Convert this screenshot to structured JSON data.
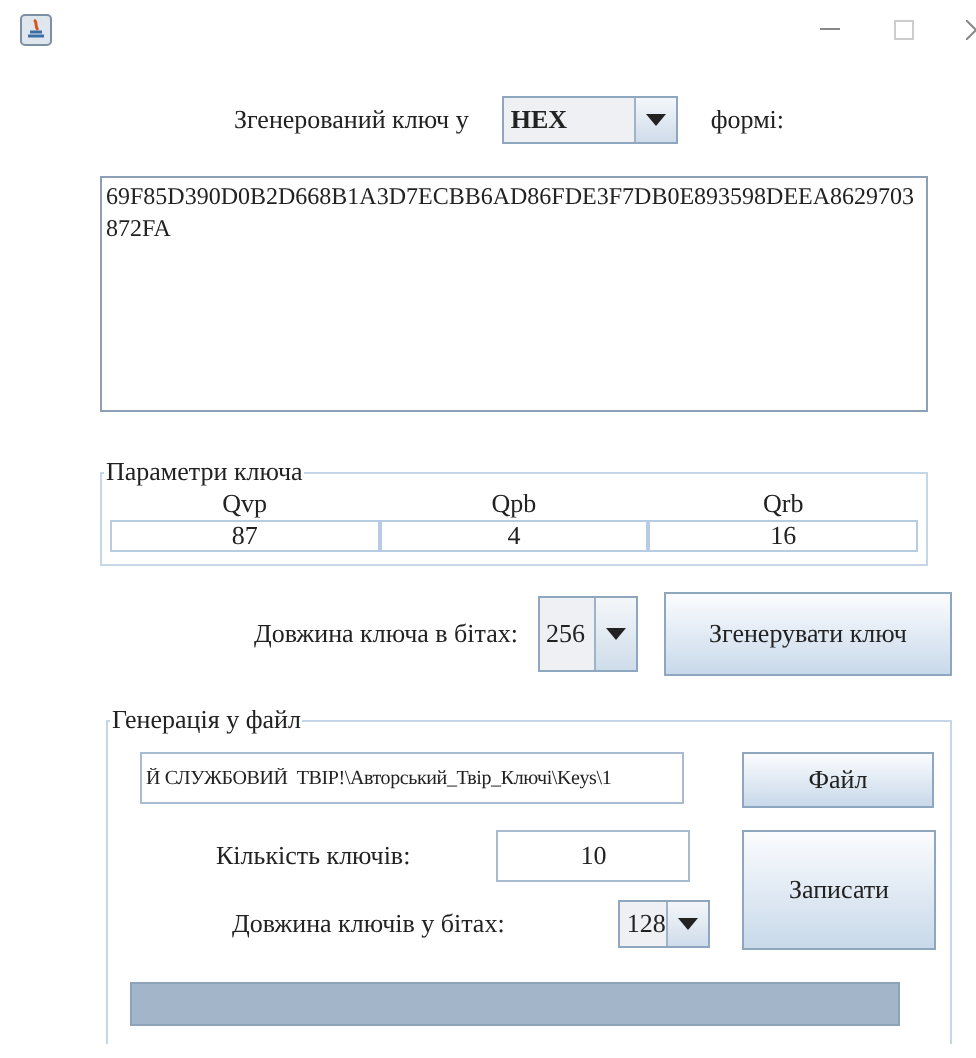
{
  "format_row": {
    "label": "Згенерований ключ у",
    "format": "HEX",
    "suffix": "формі:"
  },
  "key_output": {
    "value": "69F85D390D0B2D668B1A3D7ECBB6AD86FDE3F7DB0E893598DEEA8629703872FA"
  },
  "parameters": {
    "title": "Параметри ключа",
    "columns": [
      "Qvp",
      "Qpb",
      "Qrb"
    ],
    "values": [
      "87",
      "4",
      "16"
    ]
  },
  "length_row": {
    "label": "Довжина ключа в бітах:",
    "length": "256",
    "button": "Згенерувати ключ"
  },
  "file_generation": {
    "title": "Генерація у файл",
    "path": "Й СЛУЖБОВИЙ  ТВІР!\\Авторський_Твір_Ключі\\Keys\\1",
    "file_button": "Файл",
    "count_label": "Кількість ключів:",
    "count": "10",
    "write_button": "Записати",
    "length_label": "Довжина ключів у бітах:",
    "length": "128",
    "progress": {
      "level": 1
    }
  }
}
